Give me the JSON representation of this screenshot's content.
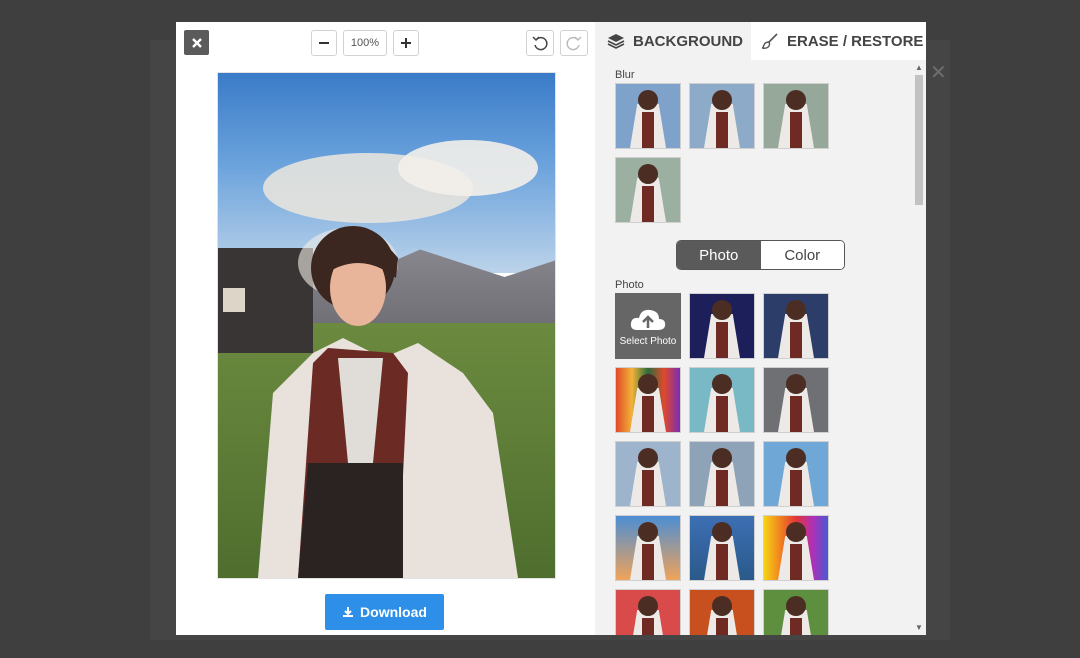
{
  "colors": {
    "overlay": "#3f3f3f",
    "panel": "#f2f2f2",
    "download_button": "#2e8fe8",
    "toggle_active": "#5a5a5a",
    "tab_text": "#444444"
  },
  "editor": {
    "close_icon": "close-icon",
    "zoom": {
      "value": "100%",
      "minus_icon": "minus-icon",
      "plus_icon": "plus-icon"
    },
    "undo_icon": "undo-icon",
    "redo_icon": "redo-icon",
    "download_label": "Download",
    "download_icon": "download-icon"
  },
  "panel": {
    "tabs": [
      {
        "label": "BACKGROUND",
        "icon": "layers-icon",
        "active": true
      },
      {
        "label": "ERASE / RESTORE",
        "icon": "brush-icon",
        "active": false
      }
    ],
    "blur_label": "Blur",
    "toggle": {
      "photo": "Photo",
      "color": "Color",
      "selected": "Photo"
    },
    "photo_label": "Photo",
    "select_photo_label": "Select Photo",
    "upload_icon": "cloud-upload-icon",
    "blur_thumbs": [
      "blur-1",
      "blur-2",
      "blur-3",
      "blur-4"
    ],
    "photo_thumbs": [
      "space",
      "night-city",
      "color-stripes",
      "bokeh",
      "city-street",
      "city-skyline",
      "urban",
      "tower",
      "beach-sunset",
      "lake",
      "rainbow",
      "flowers",
      "autumn",
      "forest"
    ]
  }
}
